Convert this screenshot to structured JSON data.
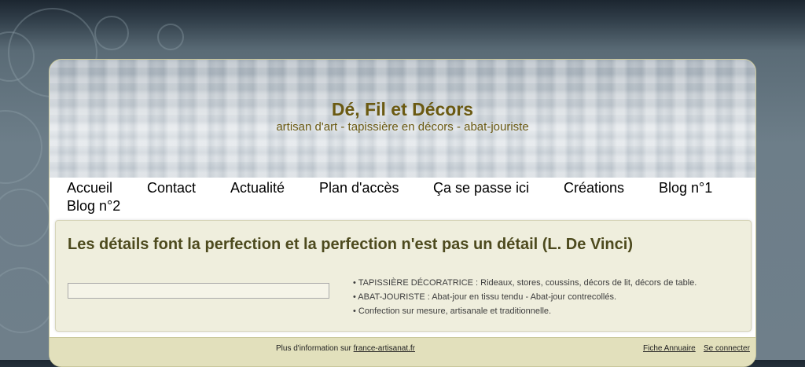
{
  "header": {
    "title": "Dé, Fil et Décors",
    "subtitle": "artisan d'art - tapissière en décors - abat-jouriste"
  },
  "nav": {
    "items": [
      {
        "label": "Accueil"
      },
      {
        "label": "Contact"
      },
      {
        "label": "Actualité"
      },
      {
        "label": "Plan d'accès"
      },
      {
        "label": "Ça se passe ici"
      },
      {
        "label": "Créations"
      },
      {
        "label": "Blog n°1"
      },
      {
        "label": "Blog n°2"
      }
    ]
  },
  "main": {
    "quote": "Les détails font la perfection et la perfection n'est pas un détail (L. De Vinci)",
    "search_value": "",
    "bullets": [
      "• TAPISSIÈRE DÉCORATRICE : Rideaux, stores, coussins, décors de lit, décors de table.",
      "• ABAT-JOURISTE : Abat-jour en tissu tendu - Abat-jour contrecollés.",
      "• Confection sur mesure, artisanale et traditionnelle."
    ]
  },
  "footer": {
    "info_prefix": "Plus d'information sur ",
    "info_link": "france-artisanat.fr",
    "link_annuaire": "Fiche Annuaire",
    "link_login": "Se connecter"
  },
  "colors": {
    "title": "#6b5a12",
    "quote": "#4d4a1e",
    "content_bg": "#efeedd",
    "footer_bg": "#e2e0bc"
  }
}
